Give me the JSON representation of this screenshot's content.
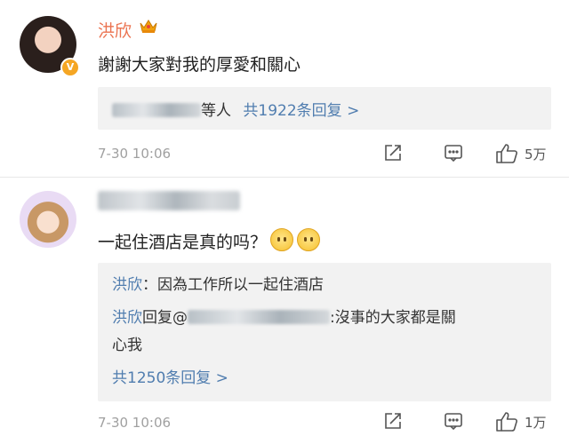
{
  "comments": [
    {
      "username": "洪欣",
      "text": "謝謝大家對我的厚愛和關心",
      "reply_summary": {
        "suffix": "等人",
        "count_link": "共1922条回复 >"
      },
      "timestamp": "7-30 10:06",
      "likes": "5万",
      "verified_badge": "V"
    },
    {
      "text": "一起住酒店是真的吗？",
      "replies": [
        {
          "author": "洪欣",
          "text": "：因為工作所以一起住酒店"
        },
        {
          "author": "洪欣",
          "reply_word": "回复@",
          "text_line1": ":沒事的大家都是關",
          "text_line2": "心我"
        }
      ],
      "more_link": "共1250条回复 >",
      "timestamp": "7-30 10:06",
      "likes": "1万"
    }
  ],
  "colors": {
    "username": "#eb7350",
    "link": "#507daf",
    "meta": "#a0a0a0"
  },
  "icons": [
    "crown-icon",
    "share-icon",
    "comment-icon",
    "like-icon",
    "emoji-face-icon"
  ]
}
